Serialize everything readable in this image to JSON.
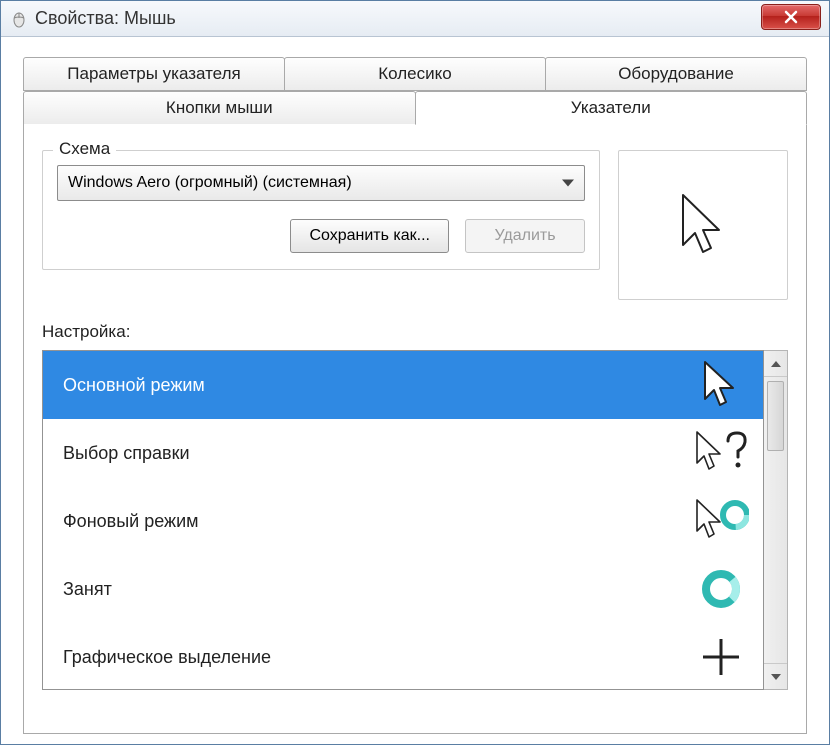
{
  "window": {
    "title": "Свойства: Мышь"
  },
  "tabs": {
    "row1": [
      {
        "label": "Параметры указателя"
      },
      {
        "label": "Колесико"
      },
      {
        "label": "Оборудование"
      }
    ],
    "row2": [
      {
        "label": "Кнопки мыши"
      },
      {
        "label": "Указатели",
        "active": true
      }
    ]
  },
  "scheme": {
    "legend": "Схема",
    "selected": "Windows Aero (огромный) (системная)",
    "save_as_label": "Сохранить как...",
    "delete_label": "Удалить"
  },
  "customize": {
    "label": "Настройка:",
    "items": [
      {
        "label": "Основной режим",
        "icon": "arrow",
        "selected": true
      },
      {
        "label": "Выбор справки",
        "icon": "arrow-help"
      },
      {
        "label": "Фоновый режим",
        "icon": "arrow-ring"
      },
      {
        "label": "Занят",
        "icon": "ring"
      },
      {
        "label": "Графическое выделение",
        "icon": "cross"
      }
    ]
  }
}
